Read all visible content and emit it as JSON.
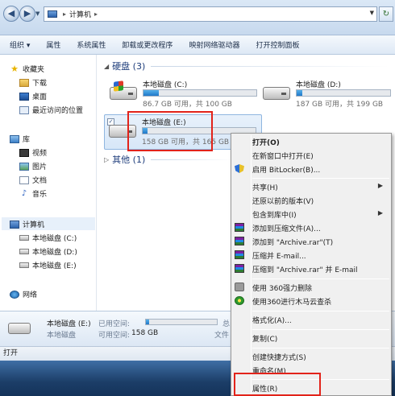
{
  "address": {
    "path": "计算机"
  },
  "toolbar": {
    "organize": "组织 ▾",
    "properties": "属性",
    "system_properties": "系统属性",
    "uninstall": "卸载或更改程序",
    "map_drive": "映射网络驱动器",
    "control_panel": "打开控制面板"
  },
  "sidebar": {
    "favorites": "收藏夹",
    "downloads": "下载",
    "desktop": "桌面",
    "recent": "最近访问的位置",
    "libraries": "库",
    "video": "视频",
    "pictures": "图片",
    "documents": "文档",
    "music": "音乐",
    "computer": "计算机",
    "drive_c": "本地磁盘 (C:)",
    "drive_d": "本地磁盘 (D:)",
    "drive_e": "本地磁盘 (E:)",
    "network": "网络"
  },
  "main": {
    "hdd_group": "硬盘 (3)",
    "other_group": "其他 (1)",
    "drives": [
      {
        "name": "本地磁盘 (C:)",
        "info": "86.7 GB 可用，共 100 GB",
        "used_fraction": 0.133
      },
      {
        "name": "本地磁盘 (D:)",
        "info": "187 GB 可用，共 199 GB",
        "used_fraction": 0.06
      },
      {
        "name": "本地磁盘 (E:)",
        "info": "158 GB 可用，共 165 GB",
        "used_fraction": 0.042
      }
    ]
  },
  "details": {
    "name": "本地磁盘 (E:)",
    "type": "本地磁盘",
    "used_label": "已用空间:",
    "free_label": "可用空间:",
    "free_value": "158 GB",
    "used_fraction": 0.042,
    "cut_total": "总",
    "cut_fs": "文件"
  },
  "status": {
    "text": "打开"
  },
  "context_menu": {
    "open": "打开(O)",
    "open_new_window": "在新窗口中打开(E)",
    "bitlocker": "启用 BitLocker(B)...",
    "share": "共享(H)",
    "restore": "还原以前的版本(V)",
    "include_library": "包含到库中(I)",
    "add_archive": "添加到压缩文件(A)...",
    "add_archive_rar": "添加到 \"Archive.rar\"(T)",
    "compress_email": "压缩并 E-mail...",
    "compress_rar_email": "压缩到 \"Archive.rar\" 并 E-mail",
    "del360": "使用 360强力删除",
    "scan360": "使用360进行木马云查杀",
    "format": "格式化(A)...",
    "copy": "复制(C)",
    "shortcut": "创建快捷方式(S)",
    "rename": "重命名(M)",
    "properties": "属性(R)"
  }
}
